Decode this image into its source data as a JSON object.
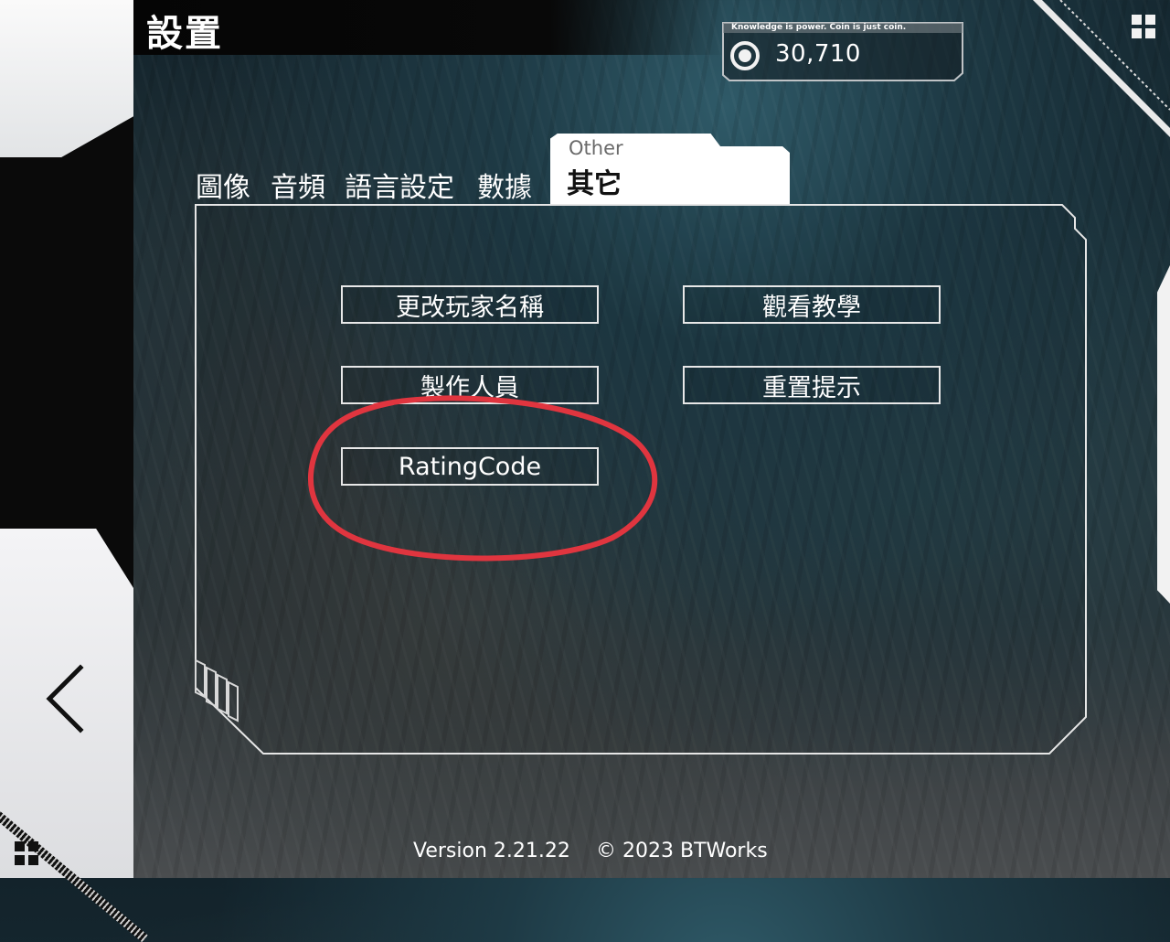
{
  "header": {
    "title": "設置"
  },
  "coins": {
    "motto": "Knowledge is power. Coin is just coin.",
    "value": "30,710",
    "icon": "coin-icon"
  },
  "tabs": [
    {
      "label": "圖像",
      "active": false
    },
    {
      "label": "音頻",
      "active": false
    },
    {
      "label": "語言設定",
      "active": false
    },
    {
      "label": "數據",
      "active": false
    },
    {
      "label": "其它",
      "label_en": "Other",
      "active": true
    }
  ],
  "buttons": {
    "change_name": "更改玩家名稱",
    "watch_tutorial": "觀看教學",
    "credits": "製作人員",
    "reset_hints": "重置提示",
    "rating_code": "RatingCode"
  },
  "footer": {
    "version": "Version 2.21.22",
    "copyright": "© 2023 BTWorks"
  },
  "annotation": {
    "color": "#e0353f"
  },
  "icons": {
    "back": "chevron-left-icon",
    "menu": "grid-icon"
  }
}
